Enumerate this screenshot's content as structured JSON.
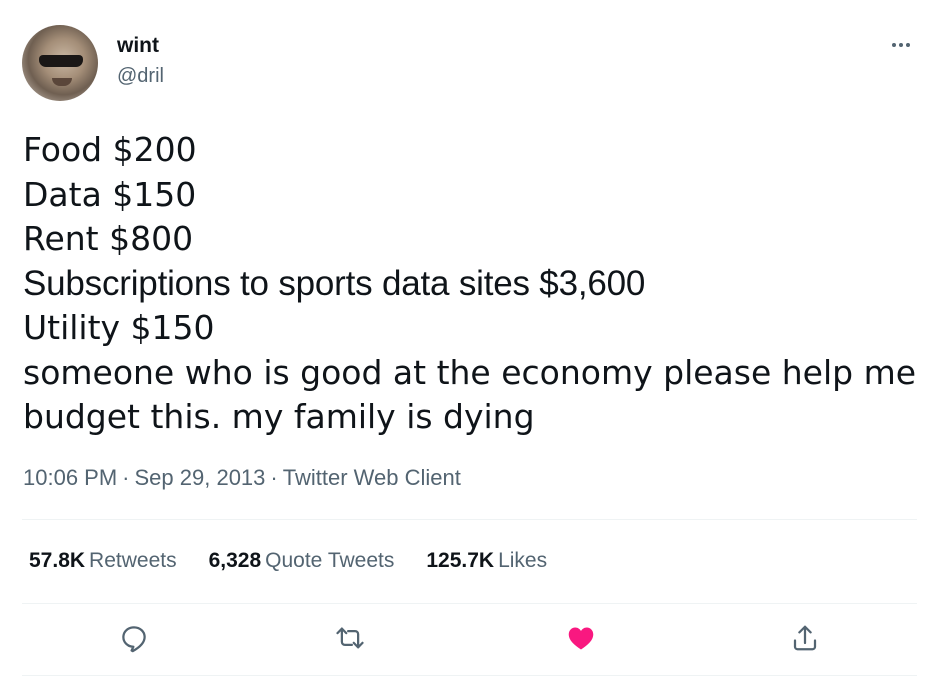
{
  "user": {
    "display_name": "wint",
    "handle": "@dril"
  },
  "tweet": {
    "lines": [
      "Food $200",
      "Data $150",
      "Rent $800",
      "Subscriptions to sports data sites $3,600",
      "Utility $150",
      "someone who is good at the economy please help me",
      "budget this. my family is dying"
    ]
  },
  "meta": {
    "time": "10:06 PM",
    "date": "Sep 29, 2013",
    "source": "Twitter Web Client",
    "separator": "·"
  },
  "stats": {
    "retweets": {
      "count": "57.8K",
      "label": "Retweets"
    },
    "quotes": {
      "count": "6,328",
      "label": "Quote Tweets"
    },
    "likes": {
      "count": "125.7K",
      "label": "Likes"
    }
  },
  "icons": {
    "more": "more-options-icon",
    "reply": "reply-icon",
    "retweet": "retweet-icon",
    "like": "heart-icon",
    "share": "share-icon"
  },
  "colors": {
    "text_primary": "#0f1419",
    "text_secondary": "#536471",
    "like_active": "#f91880",
    "divider": "#eff3f4"
  },
  "state": {
    "liked": true
  }
}
